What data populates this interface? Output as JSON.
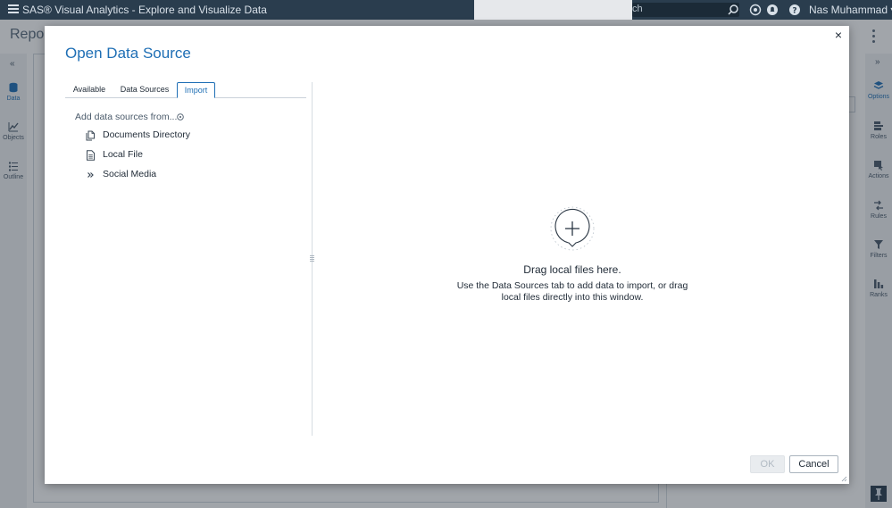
{
  "app": {
    "title": "SAS® Visual Analytics - Explore and Visualize Data",
    "search_fragment": "ch",
    "user_name": "Nas Muhammad",
    "report_title_fragment": "Repor"
  },
  "left_rail": {
    "items": [
      {
        "label": "Data",
        "icon": "data-icon",
        "active": true
      },
      {
        "label": "Objects",
        "icon": "objects-icon",
        "active": false
      },
      {
        "label": "Outline",
        "icon": "outline-icon",
        "active": false
      }
    ]
  },
  "right_rail": {
    "items": [
      {
        "label": "Options",
        "icon": "options-icon",
        "active": true
      },
      {
        "label": "Roles",
        "icon": "roles-icon",
        "active": false
      },
      {
        "label": "Actions",
        "icon": "actions-icon",
        "active": false
      },
      {
        "label": "Rules",
        "icon": "rules-icon",
        "active": false
      },
      {
        "label": "Filters",
        "icon": "filters-icon",
        "active": false
      },
      {
        "label": "Ranks",
        "icon": "ranks-icon",
        "active": false
      }
    ]
  },
  "dialog": {
    "title": "Open Data Source",
    "tabs": [
      {
        "label": "Available",
        "active": false
      },
      {
        "label": "Data Sources",
        "active": false
      },
      {
        "label": "Import",
        "active": true
      }
    ],
    "add_from_label": "Add data sources from...",
    "sources": [
      {
        "label": "Documents Directory",
        "icon": "documents-icon"
      },
      {
        "label": "Local File",
        "icon": "file-icon"
      },
      {
        "label": "Social Media",
        "icon": "double-chevron-icon"
      }
    ],
    "drop_title": "Drag local files here.",
    "drop_hint": "Use the Data Sources tab to add data to import, or drag local files directly into this window.",
    "ok_label": "OK",
    "cancel_label": "Cancel",
    "close_symbol": "×"
  },
  "colors": {
    "topbar": "#2a3d4e",
    "accent": "#1f6fb5",
    "overlay": "rgba(30,40,52,0.42)"
  }
}
